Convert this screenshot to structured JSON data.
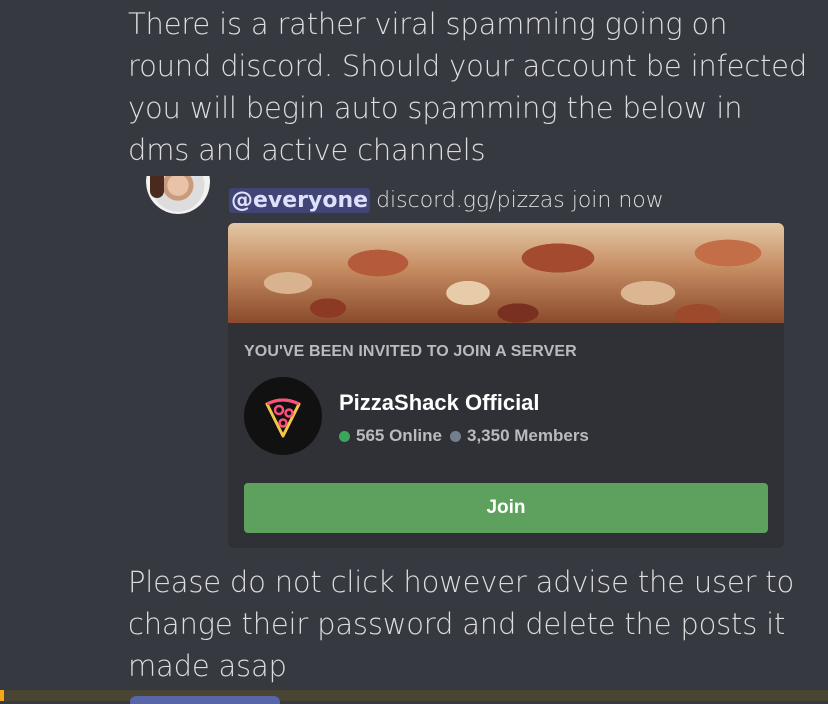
{
  "message": {
    "intro": "There is a rather viral spamming going on round discord. Should your account be infected you will begin auto spamming the below in dms and active channels",
    "outro": "Please do not click however advise the user to change their password and delete the posts it made asap"
  },
  "quoted_message": {
    "mention": "@everyone",
    "text": "discord.gg/pizzas join now"
  },
  "invite": {
    "title": "YOU'VE BEEN INVITED TO JOIN A SERVER",
    "server_name": "PizzaShack Official",
    "online": "565 Online",
    "members": "3,350 Members",
    "join_label": "Join"
  },
  "colors": {
    "background": "#36393f",
    "embed": "#2f3136",
    "join_button": "#5ea05e",
    "online_dot": "#3ba55c",
    "mention": "#5865f2"
  },
  "icons": {
    "server_icon": "neon-pizza-slice-icon"
  }
}
